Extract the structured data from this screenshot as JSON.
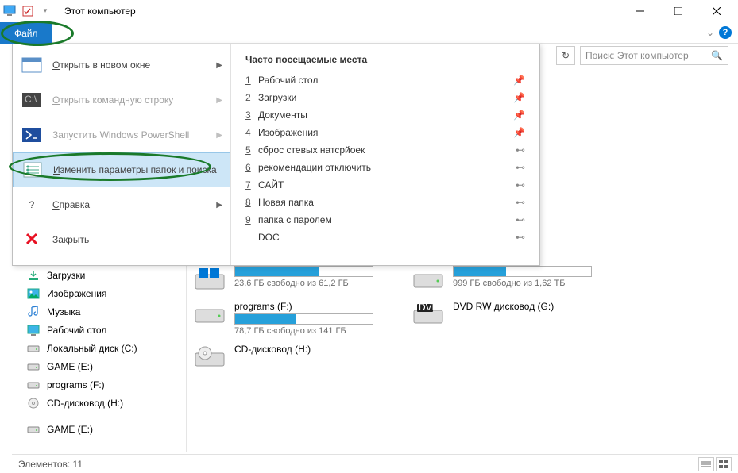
{
  "titlebar": {
    "title": "Этот компьютер"
  },
  "ribbon": {
    "file_tab": "Файл"
  },
  "search": {
    "placeholder": "Поиск: Этот компьютер"
  },
  "file_menu": {
    "left": [
      {
        "label": "Открыть в новом окне",
        "icon": "window",
        "chev": true
      },
      {
        "label": "Открыть командную строку",
        "icon": "cmd",
        "disabled": true,
        "chev": true
      },
      {
        "label": "Запустить Windows PowerShell",
        "icon": "ps",
        "disabled": true,
        "chev": true
      },
      {
        "label": "Изменить параметры папок и поиска",
        "icon": "options",
        "highlight": true
      },
      {
        "label": "Справка",
        "icon": "help",
        "chev": true
      },
      {
        "label": "Закрыть",
        "icon": "close"
      }
    ],
    "right_header": "Часто посещаемые места",
    "right_items": [
      {
        "n": "1",
        "label": "Рабочий стол",
        "pinned": true
      },
      {
        "n": "2",
        "label": "Загрузки",
        "pinned": true
      },
      {
        "n": "3",
        "label": "Документы",
        "pinned": true
      },
      {
        "n": "4",
        "label": "Изображения",
        "pinned": true
      },
      {
        "n": "5",
        "label": "сброс стевых натсрйоек",
        "pinned": false
      },
      {
        "n": "6",
        "label": "рекомендации отключить",
        "pinned": false
      },
      {
        "n": "7",
        "label": "САЙТ",
        "pinned": false
      },
      {
        "n": "8",
        "label": "Новая папка",
        "pinned": false
      },
      {
        "n": "9",
        "label": "папка с паролем",
        "pinned": false
      },
      {
        "n": "",
        "label": "DOC",
        "pinned": false
      }
    ]
  },
  "sidebar": {
    "items": [
      {
        "label": "Загрузки",
        "icon": "download"
      },
      {
        "label": "Изображения",
        "icon": "image"
      },
      {
        "label": "Музыка",
        "icon": "music"
      },
      {
        "label": "Рабочий стол",
        "icon": "desktop"
      },
      {
        "label": "Локальный диск (C:)",
        "icon": "disk"
      },
      {
        "label": "GAME (E:)",
        "icon": "disk"
      },
      {
        "label": "programs (F:)",
        "icon": "disk"
      },
      {
        "label": "CD-дисковод (H:)",
        "icon": "cd"
      }
    ],
    "group2": [
      {
        "label": "GAME (E:)",
        "icon": "disk"
      }
    ]
  },
  "drives": [
    {
      "name": "",
      "info": "23,6 ГБ свободно из 61,2 ГБ",
      "fill": 61,
      "icon": "win"
    },
    {
      "name": "",
      "info": "999 ГБ свободно из 1,62 ТБ",
      "fill": 38,
      "icon": "disk"
    },
    {
      "name": "programs (F:)",
      "info": "78,7 ГБ свободно из 141 ГБ",
      "fill": 44,
      "icon": "disk"
    },
    {
      "name": "DVD RW дисковод (G:)",
      "info": "",
      "fill": null,
      "icon": "dvd"
    },
    {
      "name": "CD-дисковод (H:)",
      "info": "",
      "fill": null,
      "icon": "cd"
    }
  ],
  "statusbar": {
    "text": "Элементов: 11"
  }
}
